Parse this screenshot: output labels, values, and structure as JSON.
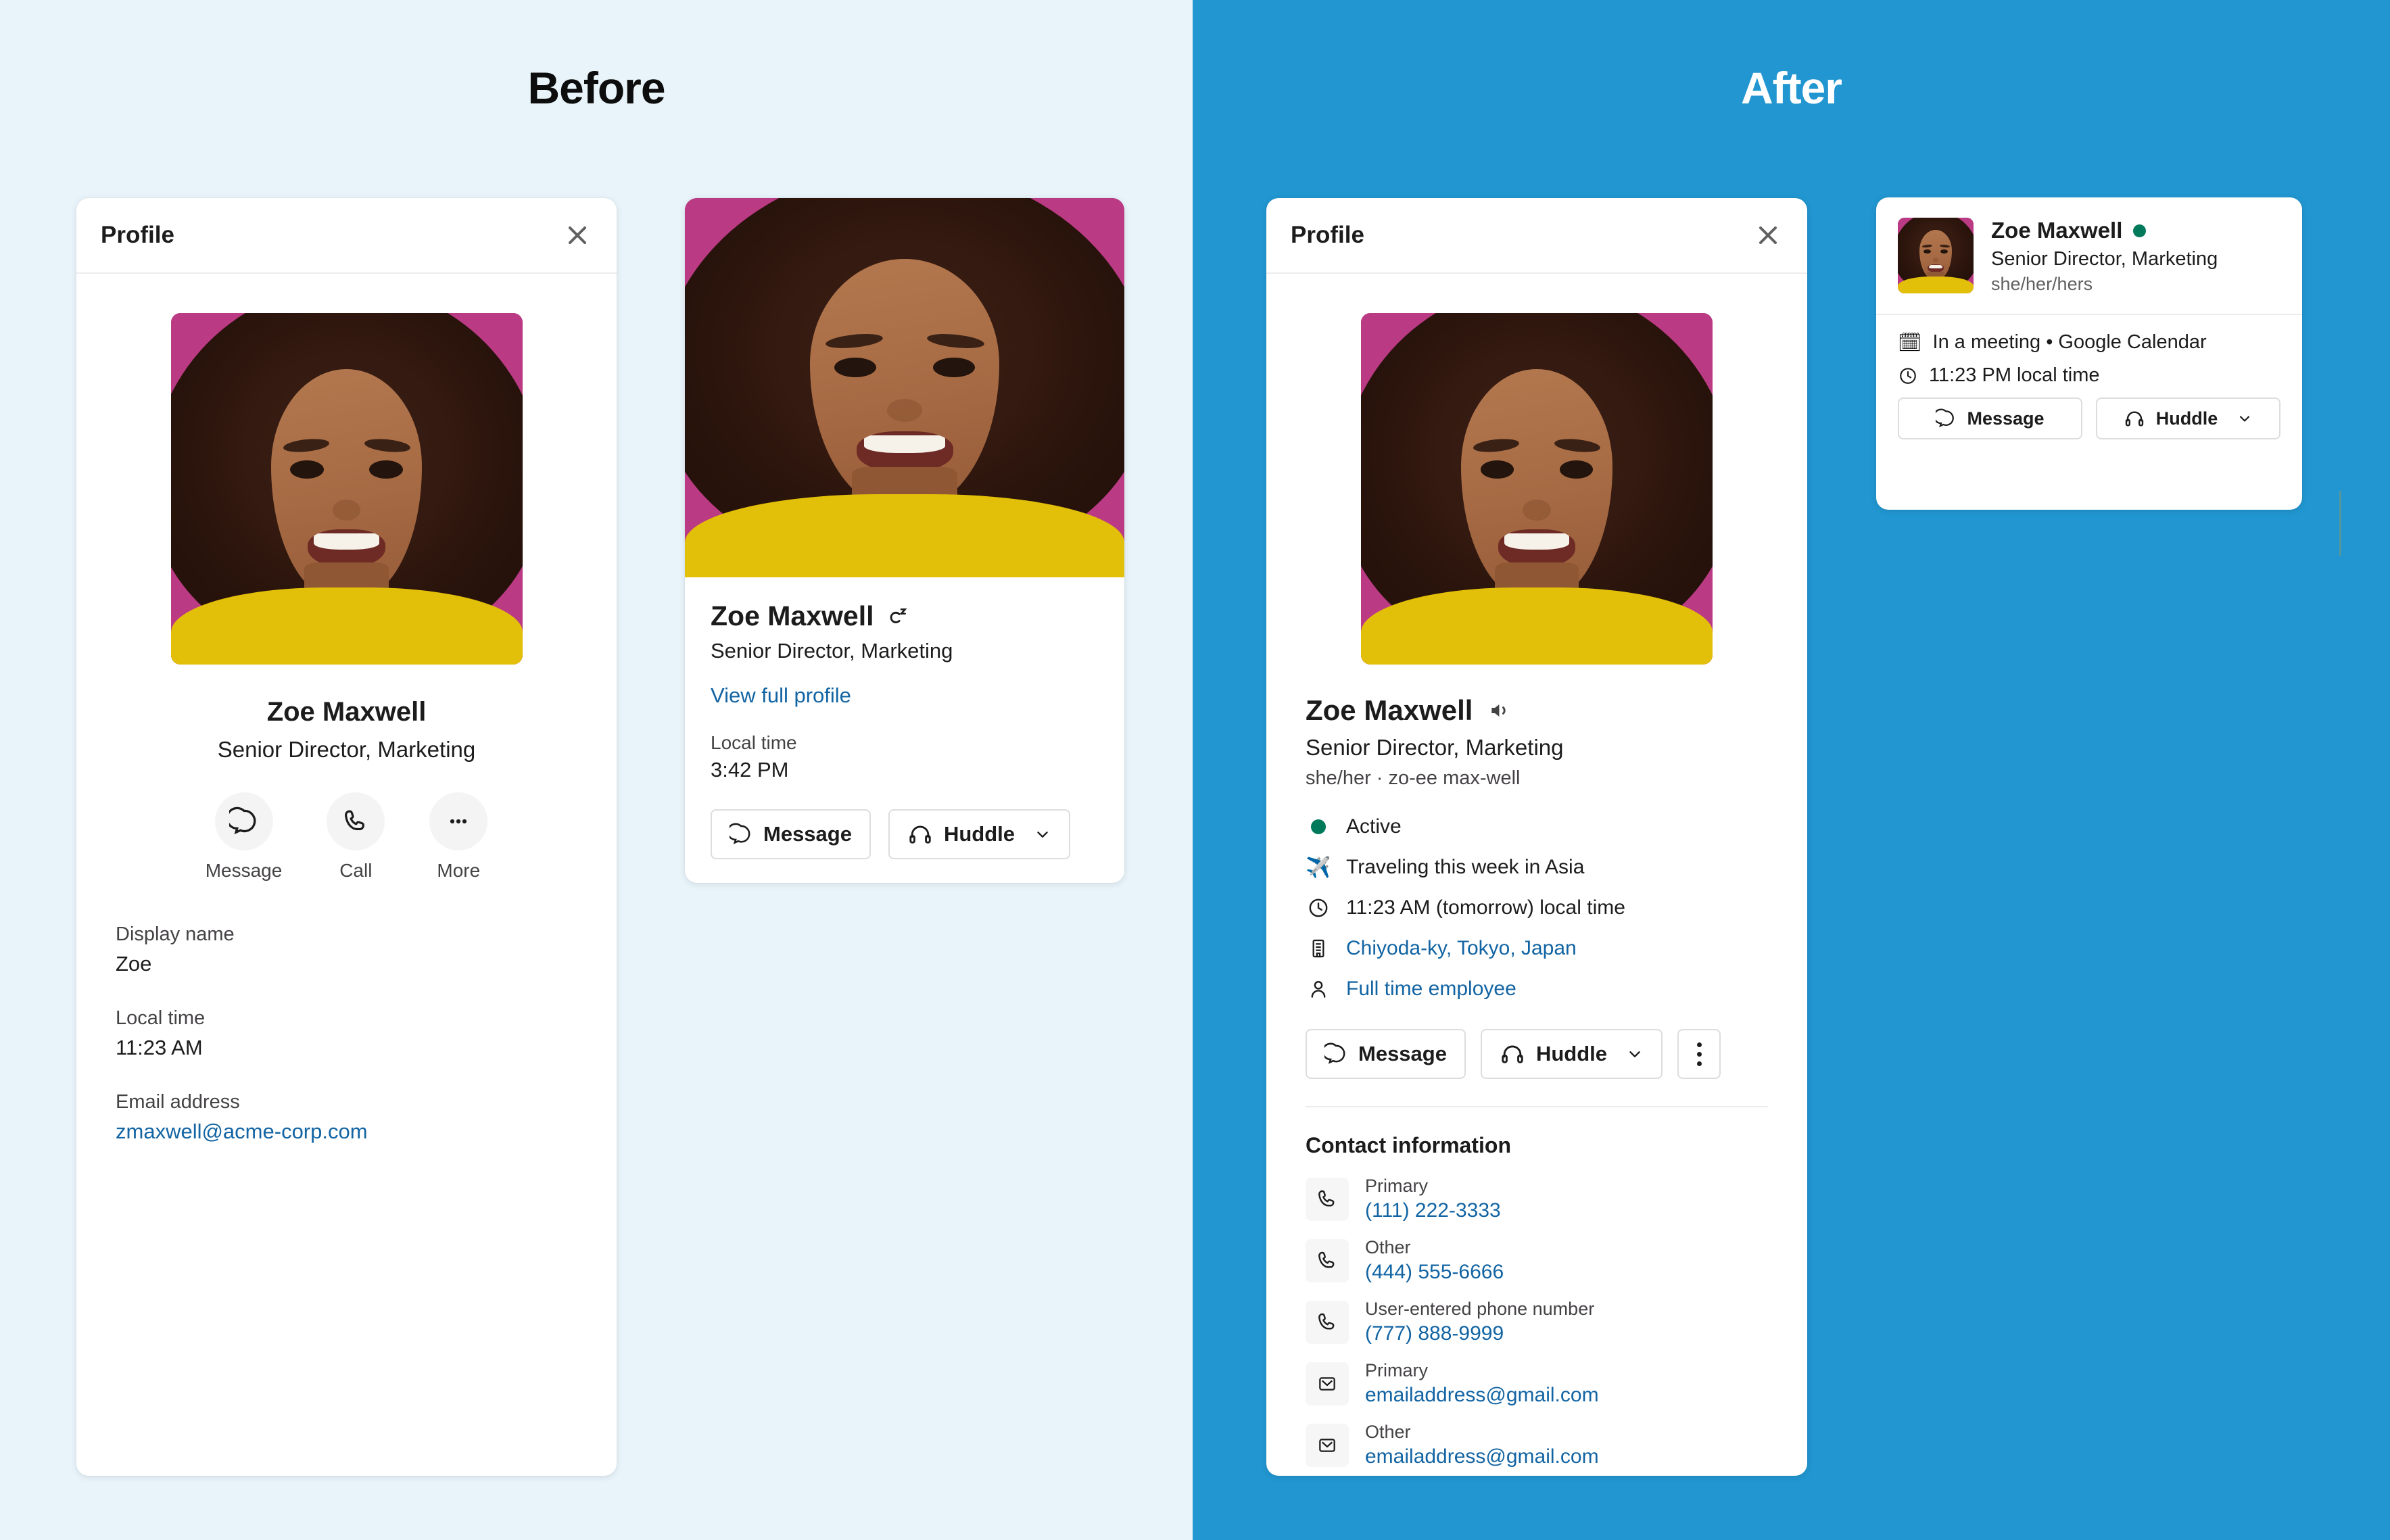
{
  "panels": {
    "before": {
      "title": "Before",
      "bg": "#e8f4fa",
      "title_color": "#0d0d0d"
    },
    "after": {
      "title": "After",
      "bg": "#2196d0",
      "title_color": "#ffffff"
    }
  },
  "before_profile_card": {
    "header_title": "Profile",
    "close_icon": "close-icon",
    "avatar_icon": "user-avatar",
    "name": "Zoe Maxwell",
    "title": "Senior Director, Marketing",
    "actions": [
      {
        "label": "Message",
        "icon": "message-icon"
      },
      {
        "label": "Call",
        "icon": "phone-icon"
      },
      {
        "label": "More",
        "icon": "more-icon"
      }
    ],
    "fields": [
      {
        "label": "Display name",
        "value": "Zoe",
        "is_link": false
      },
      {
        "label": "Local time",
        "value": "11:23 AM",
        "is_link": false
      },
      {
        "label": "Email address",
        "value": "zmaxwell@acme-corp.com",
        "is_link": true
      }
    ]
  },
  "before_hover_card": {
    "avatar_icon": "user-avatar",
    "name": "Zoe Maxwell",
    "status_icon": "away-zzz-icon",
    "title": "Senior Director, Marketing",
    "link": "View full profile",
    "local_time_label": "Local time",
    "local_time_value": "3:42 PM",
    "buttons": {
      "message": "Message",
      "huddle": "Huddle",
      "huddle_caret": "chevron-down-icon"
    }
  },
  "after_profile_card": {
    "header_title": "Profile",
    "close_icon": "close-icon",
    "avatar_icon": "user-avatar",
    "name": "Zoe Maxwell",
    "pronounce_icon": "speaker-icon",
    "title": "Senior Director, Marketing",
    "pronouns": "she/her · zo-ee max-well",
    "meta": [
      {
        "icon": "presence-dot-icon",
        "text": "Active",
        "is_link": false
      },
      {
        "icon": "airplane-emoji",
        "text": "Traveling this week in Asia",
        "is_link": false
      },
      {
        "icon": "clock-icon",
        "text": "11:23 AM (tomorrow) local time",
        "is_link": false
      },
      {
        "icon": "building-icon",
        "text": "Chiyoda-ky, Tokyo, Japan",
        "is_link": true
      },
      {
        "icon": "person-icon",
        "text": "Full time employee",
        "is_link": true
      }
    ],
    "buttons": {
      "message": "Message",
      "huddle": "Huddle",
      "huddle_caret": "chevron-down-icon",
      "kebab": "overflow-menu-icon"
    },
    "contact_title": "Contact information",
    "contacts": [
      {
        "icon": "phone-icon",
        "label": "Primary",
        "value": "(111) 222-3333"
      },
      {
        "icon": "phone-icon",
        "label": "Other",
        "value": "(444) 555-6666"
      },
      {
        "icon": "phone-icon",
        "label": "User-entered phone number",
        "value": "(777) 888-9999"
      },
      {
        "icon": "envelope-icon",
        "label": "Primary",
        "value": "emailaddress@gmail.com"
      },
      {
        "icon": "envelope-icon",
        "label": "Other",
        "value": "emailaddress@gmail.com"
      }
    ]
  },
  "after_hover_card": {
    "avatar_icon": "user-avatar",
    "name": "Zoe Maxwell",
    "presence": "active",
    "title": "Senior Director, Marketing",
    "pronouns": "she/her/hers",
    "status_emoji": "🗓",
    "status_text": "In a meeting • Google Calendar",
    "local_time": "11:23 PM local time",
    "buttons": {
      "message": "Message",
      "huddle": "Huddle",
      "huddle_caret": "chevron-down-icon"
    }
  },
  "colors": {
    "after_panel_blue": "#2196d0",
    "before_panel_blue": "#e8f4fa",
    "link_blue": "#1264a3",
    "presence_green": "#007a5a",
    "avatar_bg_pink": "#bb3a84",
    "avatar_shirt_yellow": "#e2bf08"
  }
}
